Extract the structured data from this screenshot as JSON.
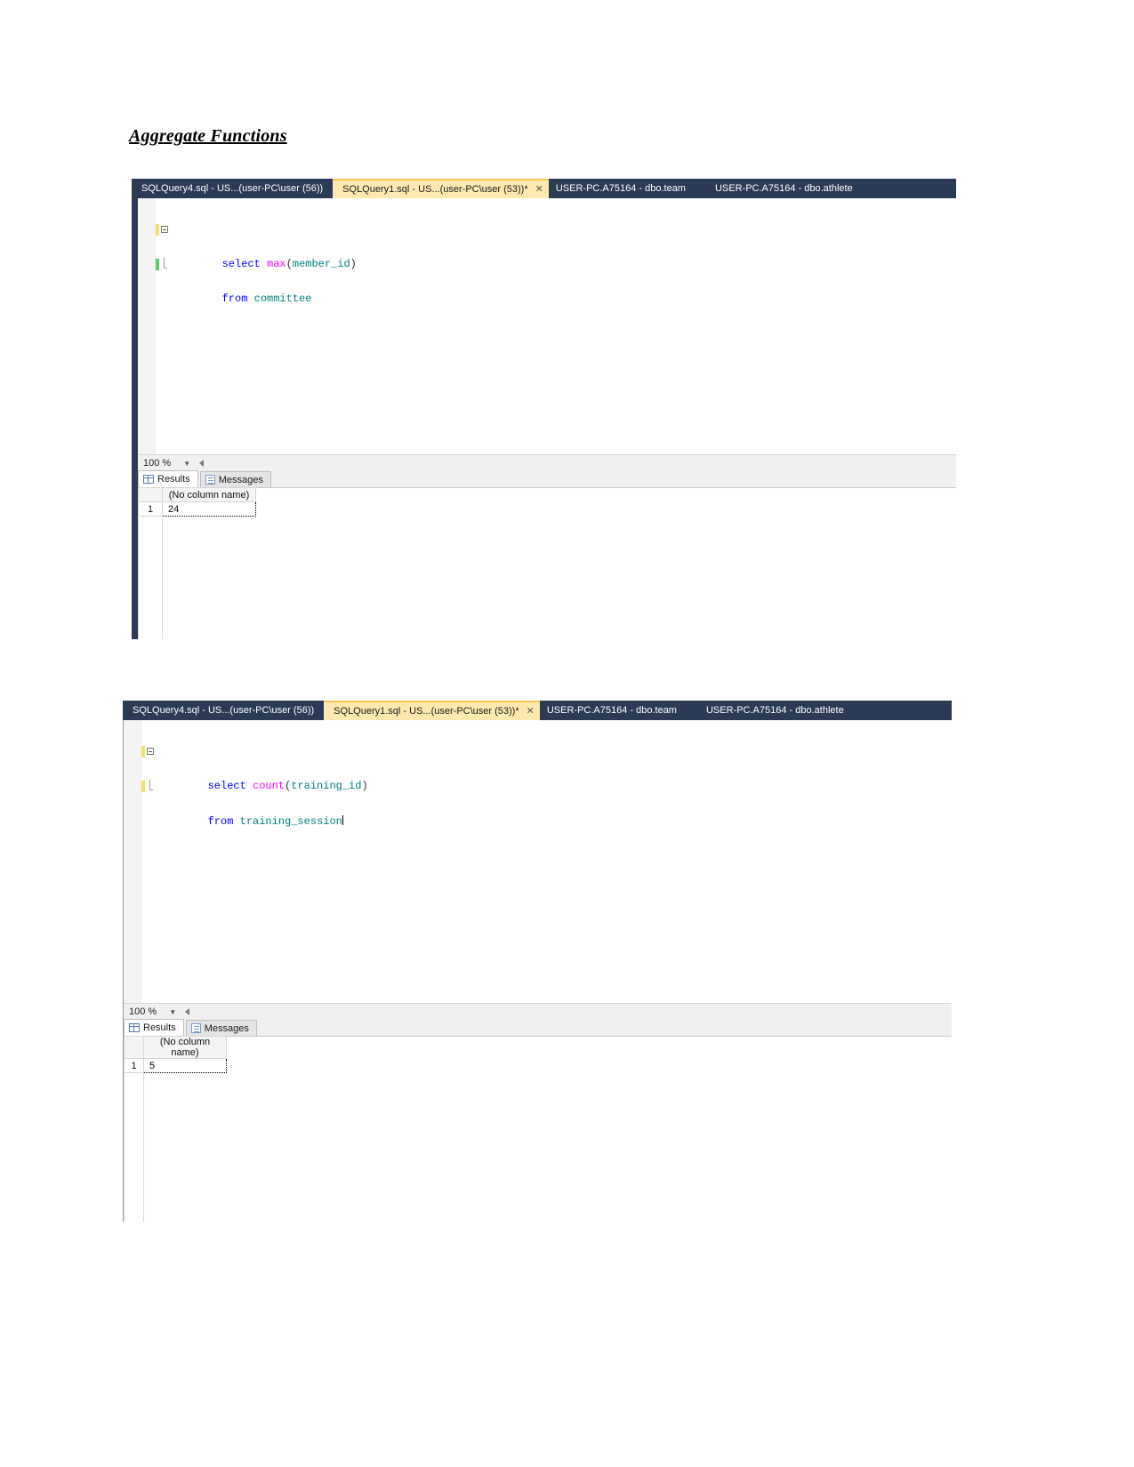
{
  "document": {
    "heading": "Aggregate Functions"
  },
  "screenshots": [
    {
      "tabs": [
        {
          "label": "SQLQuery4.sql - US...(user-PC\\user (56))",
          "active": false,
          "closable": false
        },
        {
          "label": "SQLQuery1.sql - US...(user-PC\\user (53))*",
          "active": true,
          "closable": true,
          "close_label": "✕"
        },
        {
          "label": "USER-PC.A75164 - dbo.team",
          "active": false,
          "closable": false
        },
        {
          "label": "USER-PC.A75164 - dbo.athlete",
          "active": false,
          "closable": false
        }
      ],
      "code": {
        "line1": {
          "kw": "select",
          "fn": "max",
          "open": "(",
          "id": "member_id",
          "close": ")"
        },
        "line2": {
          "kw": "from",
          "id": "committee"
        }
      },
      "zoom": {
        "value": "100 %"
      },
      "result_tabs": [
        {
          "label": "Results",
          "icon": "grid-icon",
          "active": true
        },
        {
          "label": "Messages",
          "icon": "message-icon",
          "active": false
        }
      ],
      "grid": {
        "column_header": "(No column name)",
        "rows": [
          {
            "num": "1",
            "value": "24"
          }
        ]
      }
    },
    {
      "tabs": [
        {
          "label": "SQLQuery4.sql - US...(user-PC\\user (56))",
          "active": false,
          "closable": false
        },
        {
          "label": "SQLQuery1.sql - US...(user-PC\\user (53))*",
          "active": true,
          "closable": true,
          "close_label": "✕"
        },
        {
          "label": "USER-PC.A75164 - dbo.team",
          "active": false,
          "closable": false
        },
        {
          "label": "USER-PC.A75164 - dbo.athlete",
          "active": false,
          "closable": false
        }
      ],
      "code": {
        "line1": {
          "kw": "select",
          "fn": "count",
          "open": "(",
          "id": "training_id",
          "close": ")"
        },
        "line2": {
          "kw": "from",
          "id": "training_session"
        }
      },
      "zoom": {
        "value": "100 %"
      },
      "result_tabs": [
        {
          "label": "Results",
          "icon": "grid-icon",
          "active": true
        },
        {
          "label": "Messages",
          "icon": "message-icon",
          "active": false
        }
      ],
      "grid": {
        "column_header": "(No column name)",
        "rows": [
          {
            "num": "1",
            "value": "5"
          }
        ]
      }
    }
  ],
  "colors": {
    "tab_bar": "#2b3a55",
    "active_tab": "#fde9b0",
    "keyword": "#0000ff",
    "function": "#ff00ff",
    "identifier": "#008080",
    "change_pending": "#f2e26c",
    "change_saved": "#5fcf6e"
  }
}
